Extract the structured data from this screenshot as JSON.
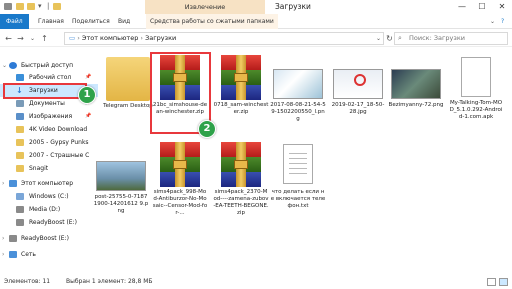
{
  "window": {
    "title": "Загрузки",
    "context_tab": "Извлечение",
    "controls": {
      "minimize": "—",
      "maximize": "☐",
      "close": "✕"
    }
  },
  "ribbon": {
    "tabs": [
      "Файл",
      "Главная",
      "Поделиться",
      "Вид",
      "Средства работы со сжатыми папками"
    ],
    "help": "?"
  },
  "address": {
    "path": [
      "Этот компьютер",
      "Загрузки"
    ],
    "search_placeholder": "Поиск: Загрузки"
  },
  "sidebar": {
    "items": [
      {
        "label": "Быстрый доступ",
        "icon": "star-icon",
        "color": "#2e7bd6"
      },
      {
        "label": "Рабочий стол",
        "icon": "desktop-icon",
        "color": "#3a8fd9",
        "pin": "📌"
      },
      {
        "label": "Загрузки",
        "icon": "download-arrow-icon",
        "color": "#2e7bd6",
        "pin": "📌"
      },
      {
        "label": "Документы",
        "icon": "documents-icon",
        "color": "#7a9bb8",
        "pin": "📌"
      },
      {
        "label": "Изображения",
        "icon": "pictures-icon",
        "color": "#5a8fc9",
        "pin": "📌"
      },
      {
        "label": "4K Video Download",
        "icon": "folder-icon",
        "color": "#e8c35a"
      },
      {
        "label": "2005 - Gypsy Punks",
        "icon": "folder-icon",
        "color": "#e8c35a"
      },
      {
        "label": "2007 - Страшные С",
        "icon": "folder-icon",
        "color": "#e8c35a"
      },
      {
        "label": "Snagit",
        "icon": "folder-icon",
        "color": "#e8c35a"
      },
      {
        "label": "Этот компьютер",
        "icon": "computer-icon",
        "color": "#4a90d9"
      },
      {
        "label": "Windows (C:)",
        "icon": "drive-icon",
        "color": "#7aa6d8"
      },
      {
        "label": "Media (D:)",
        "icon": "drive-icon",
        "color": "#8a8a8a"
      },
      {
        "label": "ReadyBoost (E:)",
        "icon": "drive-icon",
        "color": "#8a8a8a"
      },
      {
        "label": "ReadyBoost (E:)",
        "icon": "usb-drive-icon",
        "color": "#8a8a8a"
      },
      {
        "label": "Сеть",
        "icon": "network-icon",
        "color": "#4a90d9"
      }
    ]
  },
  "files": [
    {
      "name": "Telegram Desktop",
      "type": "folder"
    },
    {
      "name": "21bc_simshouse-dean-winchester.zip",
      "type": "zip"
    },
    {
      "name": "0718_sam-winchester.zip",
      "type": "zip"
    },
    {
      "name": "2017-08-08-21-54-59-1502200550_l.png",
      "type": "image"
    },
    {
      "name": "2019-02-17_18-50-28.jpg",
      "type": "image"
    },
    {
      "name": "Bezimyanny-72.png",
      "type": "image"
    },
    {
      "name": "My-Talking-Tom-MOD_5.1.0.292-Android-1.com.apk",
      "type": "file"
    },
    {
      "name": "post-25755-0-71871900-14201612 9.png",
      "type": "image"
    },
    {
      "name": "sims4pack_998-Mod-Antiburzor-No-Mosaic--Censor-Mod-for-...",
      "type": "zip"
    },
    {
      "name": "sims4pack_2370-Mod----zamena-zubov-EA-TEETH-BEGONE.zip",
      "type": "zip"
    },
    {
      "name": "что делать если не включается телефон.txt",
      "type": "text"
    }
  ],
  "annotations": {
    "downloads_badge": "1",
    "file_badge": "2"
  },
  "status": {
    "count": "Элементов: 11",
    "selection": "Выбран 1 элемент: 28,8 МБ"
  },
  "colors": {
    "highlight": "#e8383c",
    "badge": "#2fa24a",
    "accent": "#1979ca",
    "context_tab": "#f7e2c4"
  }
}
